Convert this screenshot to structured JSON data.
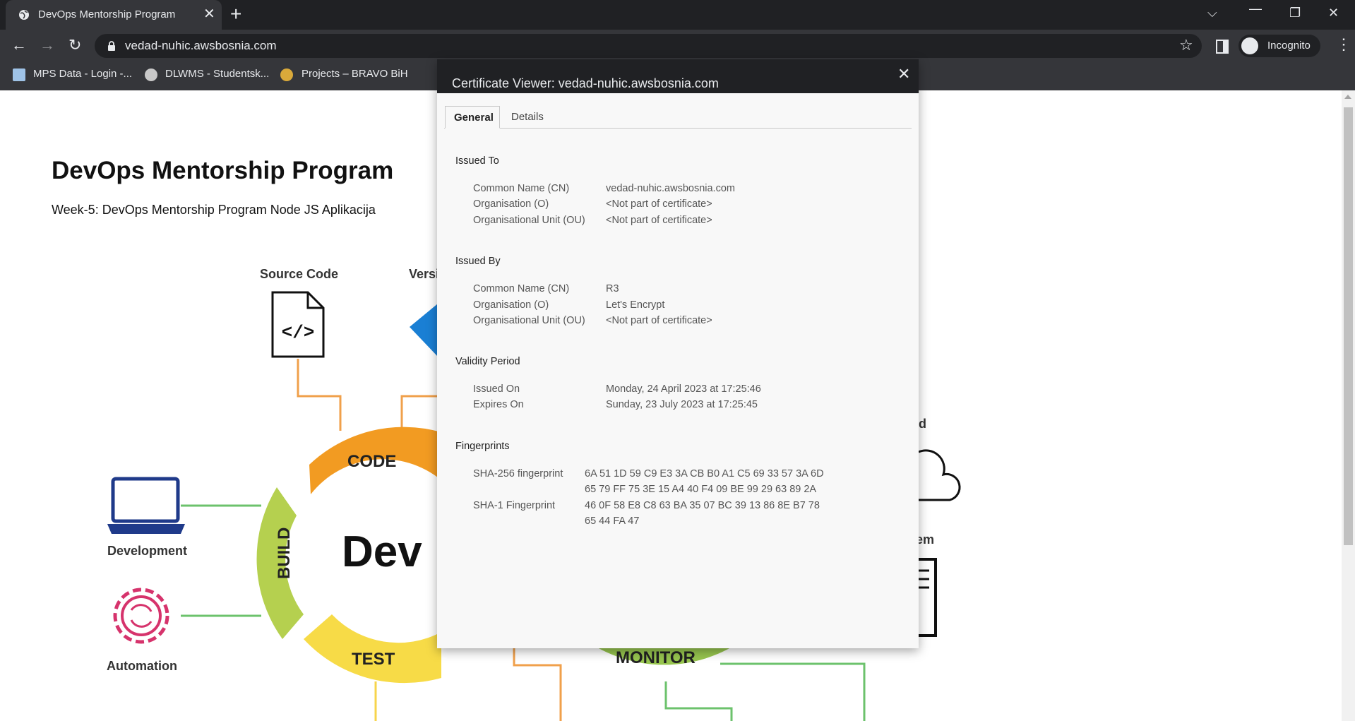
{
  "browser": {
    "tab_title": "DevOps Mentorship Program",
    "url": "vedad-nuhic.awsbosnia.com",
    "incognito_label": "Incognito",
    "bookmarks": [
      "MPS Data - Login -...",
      "DLWMS - Studentsk...",
      "Projects – BRAVO BiH"
    ]
  },
  "page": {
    "title": "DevOps Mentorship Program",
    "subtitle": "Week-5: DevOps Mentorship Program Node JS Aplikacija",
    "diagram": {
      "source_code": "Source Code",
      "version_partial": "Versi",
      "cloud_partial": "ud",
      "onprem_partial": "rem",
      "development": "Development",
      "automation": "Automation",
      "code": "CODE",
      "build": "BUILD",
      "test": "TEST",
      "monitor": "MONITOR",
      "devops_partial": "Dev"
    }
  },
  "certificate": {
    "title": "Certificate Viewer: vedad-nuhic.awsbosnia.com",
    "tabs": [
      "General",
      "Details"
    ],
    "issued_to": {
      "heading": "Issued To",
      "rows": [
        {
          "label": "Common Name (CN)",
          "value": "vedad-nuhic.awsbosnia.com"
        },
        {
          "label": "Organisation (O)",
          "value": "<Not part of certificate>"
        },
        {
          "label": "Organisational Unit (OU)",
          "value": "<Not part of certificate>"
        }
      ]
    },
    "issued_by": {
      "heading": "Issued By",
      "rows": [
        {
          "label": "Common Name (CN)",
          "value": "R3"
        },
        {
          "label": "Organisation (O)",
          "value": "Let's Encrypt"
        },
        {
          "label": "Organisational Unit (OU)",
          "value": "<Not part of certificate>"
        }
      ]
    },
    "validity": {
      "heading": "Validity Period",
      "rows": [
        {
          "label": "Issued On",
          "value": "Monday, 24 April 2023 at 17:25:46"
        },
        {
          "label": "Expires On",
          "value": "Sunday, 23 July 2023 at 17:25:45"
        }
      ]
    },
    "fingerprints": {
      "heading": "Fingerprints",
      "sha256_label": "SHA-256 fingerprint",
      "sha256_line1": "6A 51 1D 59 C9 E3 3A CB B0 A1 C5 69 33 57 3A 6D",
      "sha256_line2": "65 79 FF 75 3E 15 A4 40 F4 09 BE 99 29 63 89 2A",
      "sha1_label": "SHA-1 Fingerprint",
      "sha1_line1": "46 0F 58 E8 C8 63 BA 35 07 BC 39 13 86 8E B7 78",
      "sha1_line2": "65 44 FA 47"
    }
  }
}
